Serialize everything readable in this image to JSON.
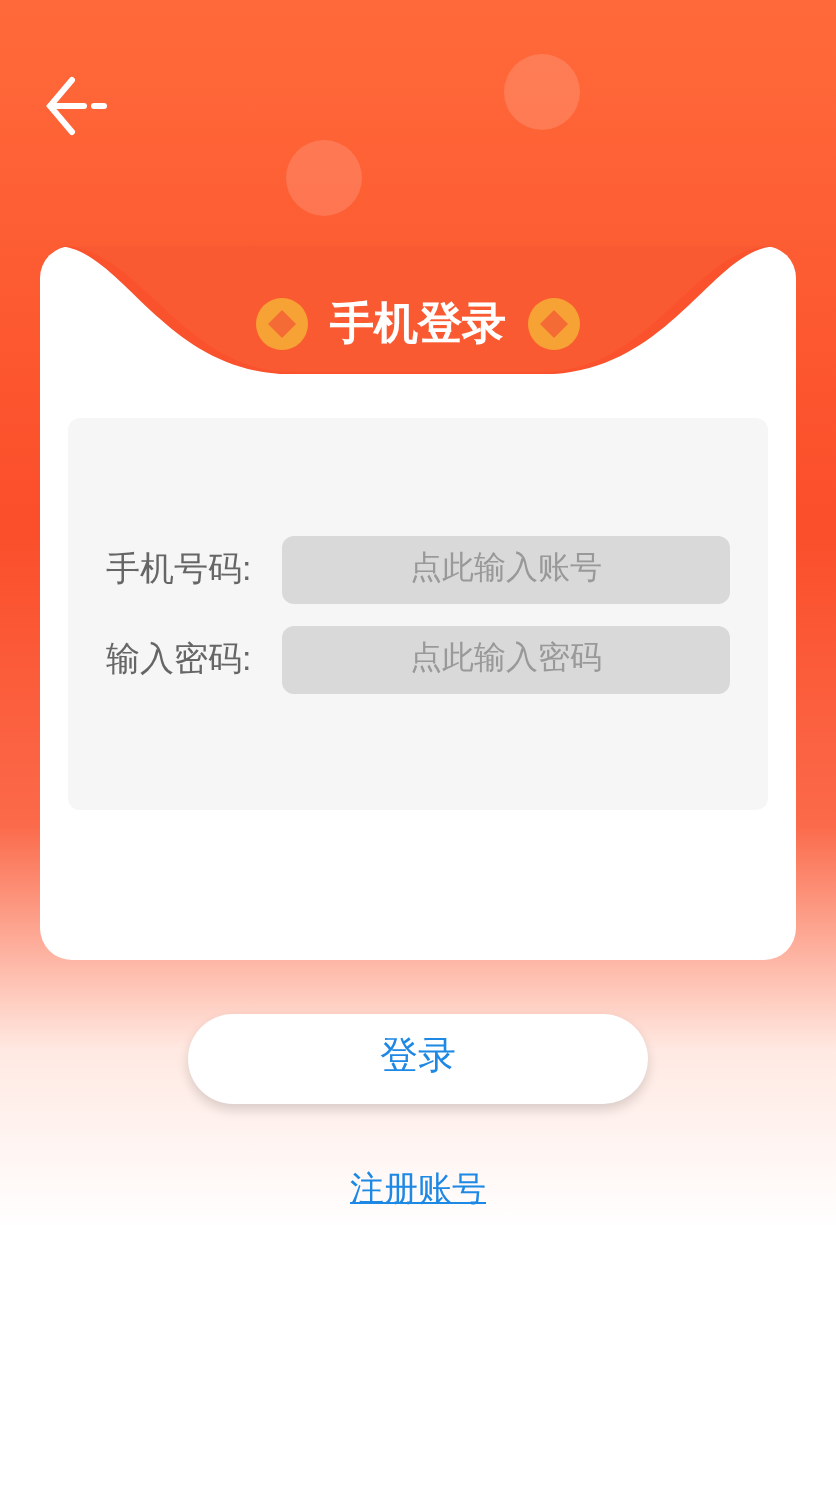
{
  "title": "手机登录",
  "fields": [
    {
      "label": "手机号码:",
      "placeholder": "点此输入账号"
    },
    {
      "label": "输入密码:",
      "placeholder": "点此输入密码"
    }
  ],
  "login_button": "登录",
  "register_link": "注册账号"
}
